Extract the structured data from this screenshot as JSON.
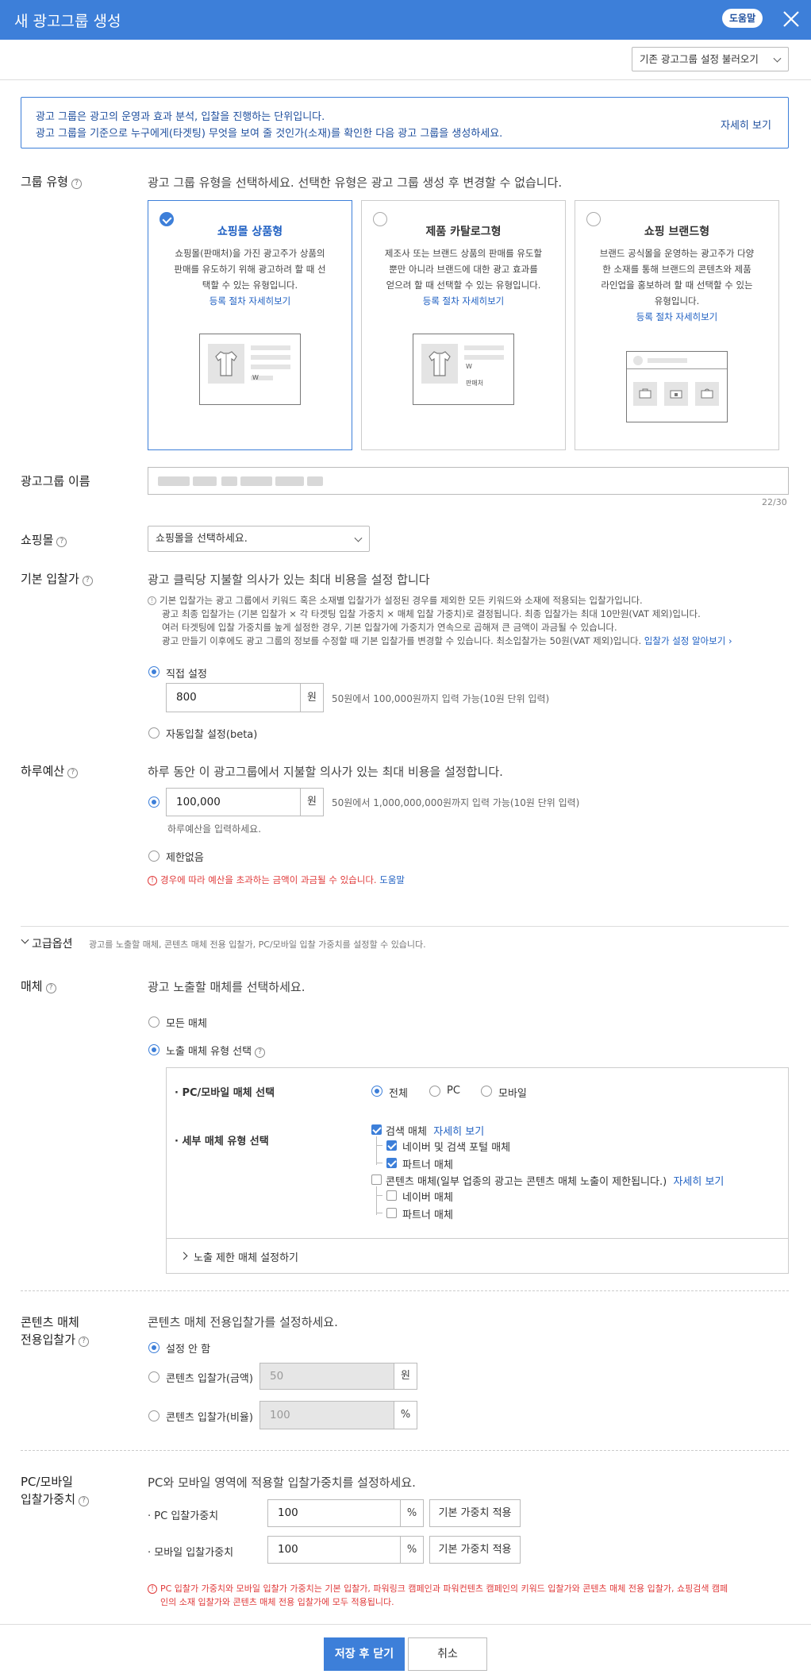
{
  "header": {
    "title": "새 광고그룹 생성",
    "help": "도움말"
  },
  "load_existing": "기존 광고그룹 설정 불러오기",
  "info": {
    "line1": "광고 그룹은 광고의 운영과 효과 분석, 입찰을 진행하는 단위입니다.",
    "line2": "광고 그룹을 기준으로 누구에게(타겟팅) 무엇을 보여 줄 것인가(소재)를 확인한 다음 광고 그룹을 생성하세요.",
    "more": "자세히 보기"
  },
  "group_type": {
    "label": "그룹 유형",
    "desc": "광고 그룹 유형을 선택하세요. 선택한 유형은 광고 그룹 생성 후 변경할 수 없습니다.",
    "cards": [
      {
        "title": "쇼핑몰 상품형",
        "lines": [
          "쇼핑몰(판매처)을 가진 광고주가 상품의",
          "판매를 유도하기 위해 광고하려 할 때 선",
          "택할 수 있는 유형입니다."
        ],
        "link": "등록 절차 자세히보기",
        "w": "W"
      },
      {
        "title": "제품 카탈로그형",
        "lines": [
          "제조사 또는 브랜드 상품의 판매를 유도할",
          "뿐만 아니라 브랜드에 대한 광고 효과를",
          "얻으려 할 때 선택할 수 있는 유형입니다."
        ],
        "link": "등록 절차 자세히보기",
        "w": "W",
        "seller": "판매처"
      },
      {
        "title": "쇼핑 브랜드형",
        "lines": [
          "브랜드 공식몰을 운영하는 광고주가 다양",
          "한 소재를 통해 브랜드의 콘텐츠와 제품",
          "라인업을 홍보하려 할 때 선택할 수 있는",
          "유형입니다."
        ],
        "link": "등록 절차 자세히보기"
      }
    ]
  },
  "group_name": {
    "label": "광고그룹 이름",
    "counter": "22/30"
  },
  "shopping_mall": {
    "label": "쇼핑몰",
    "placeholder": "쇼핑몰을 선택하세요."
  },
  "base_bid": {
    "label": "기본 입찰가",
    "desc": "광고 클릭당 지불할 의사가 있는 최대 비용을 설정 합니다",
    "notes": [
      "기본 입찰가는 광고 그룹에서 키워드 혹은 소재별 입찰가가 설정된 경우를 제외한 모든 키워드와 소재에 적용되는 입찰가입니다.",
      "광고 최종 입찰가는 (기본 입찰가 × 각 타겟팅 입찰 가중치 × 매체 입찰 가중치)로 결정됩니다. 최종 입찰가는 최대 10만원(VAT 제외)입니다.",
      "여러 타겟팅에 입찰 가중치를 높게 설정한 경우, 기본 입찰가에 가중치가 연속으로 곱해져 큰 금액이 과금될 수 있습니다.",
      "광고 만들기 이후에도 광고 그룹의 정보를 수정할 때 기본 입찰가를 변경할 수 있습니다. 최소입찰가는 50원(VAT 제외)입니다."
    ],
    "notes_link": "입찰가 설정 알아보기",
    "manual": "직접 설정",
    "value": "800",
    "unit": "원",
    "range": "50원에서 100,000원까지 입력 가능(10원 단위 입력)",
    "auto": "자동입찰 설정(beta)"
  },
  "daily_budget": {
    "label": "하루예산",
    "desc": "하루 동안 이 광고그룹에서 지불할 의사가 있는 최대 비용을 설정합니다.",
    "value": "100,000",
    "unit": "원",
    "range": "50원에서 1,000,000,000원까지 입력 가능(10원 단위 입력)",
    "hint": "하루예산을 입력하세요.",
    "unlimited": "제한없음",
    "warning": "경우에 따라 예산을 초과하는 금액이 과금될 수 있습니다.",
    "warning_link": "도움말"
  },
  "advanced": {
    "label": "고급옵션",
    "desc": "광고를 노출할 매체, 콘텐츠 매체 전용 입찰가, PC/모바일 입찰 가중치를 설정할 수 있습니다."
  },
  "media": {
    "label": "매체",
    "desc": "광고 노출할 매체를 선택하세요.",
    "all": "모든 매체",
    "select_type": "노출 매체 유형 선택",
    "pc_mobile_label": "PC/모바일 매체 선택",
    "pc_mobile_options": [
      "전체",
      "PC",
      "모바일"
    ],
    "detail_label": "세부 매체 유형 선택",
    "search": "검색 매체",
    "search_link": "자세히 보기",
    "naver_search": "네이버 및 검색 포털 매체",
    "partner1": "파트너 매체",
    "content": "콘텐츠 매체(일부 업종의 광고는 콘텐츠 매체 노출이 제한됩니다.)",
    "content_link": "자세히 보기",
    "naver_media": "네이버 매체",
    "partner2": "파트너 매체",
    "exclude": "노출 제한 매체 설정하기"
  },
  "content_bid": {
    "label1": "콘텐츠 매체",
    "label2": "전용입찰가",
    "desc": "콘텐츠 매체 전용입찰가를 설정하세요.",
    "none": "설정 안 함",
    "amount": "콘텐츠 입찰가(금액)",
    "amount_value": "50",
    "amount_unit": "원",
    "ratio": "콘텐츠 입찰가(비율)",
    "ratio_value": "100",
    "ratio_unit": "%"
  },
  "weight": {
    "label1": "PC/모바일",
    "label2": "입찰가중치",
    "desc": "PC와 모바일 영역에 적용할 입찰가중치를 설정하세요.",
    "pc_label": "PC 입찰가중치",
    "pc_value": "100",
    "mobile_label": "모바일 입찰가중치",
    "mobile_value": "100",
    "unit": "%",
    "apply": "기본 가중치 적용",
    "warn1": "PC 입찰가 가중치와 모바일 입찰가 가중치는 기본 입찰가, 파워링크 캠페인과 파워컨텐츠 캠페인의 키워드 입찰가와 콘텐츠 매체 전용 입찰가, 쇼핑검색 캠페",
    "warn2": "인의 소재 입찰가와 콘텐츠 매체 전용 입찰가에 모두 적용됩니다."
  },
  "footer": {
    "save": "저장 후 닫기",
    "cancel": "취소"
  },
  "colors": {
    "primary": "#3d7fd9",
    "link": "#1e5fc2",
    "warning": "#e03a3a"
  }
}
